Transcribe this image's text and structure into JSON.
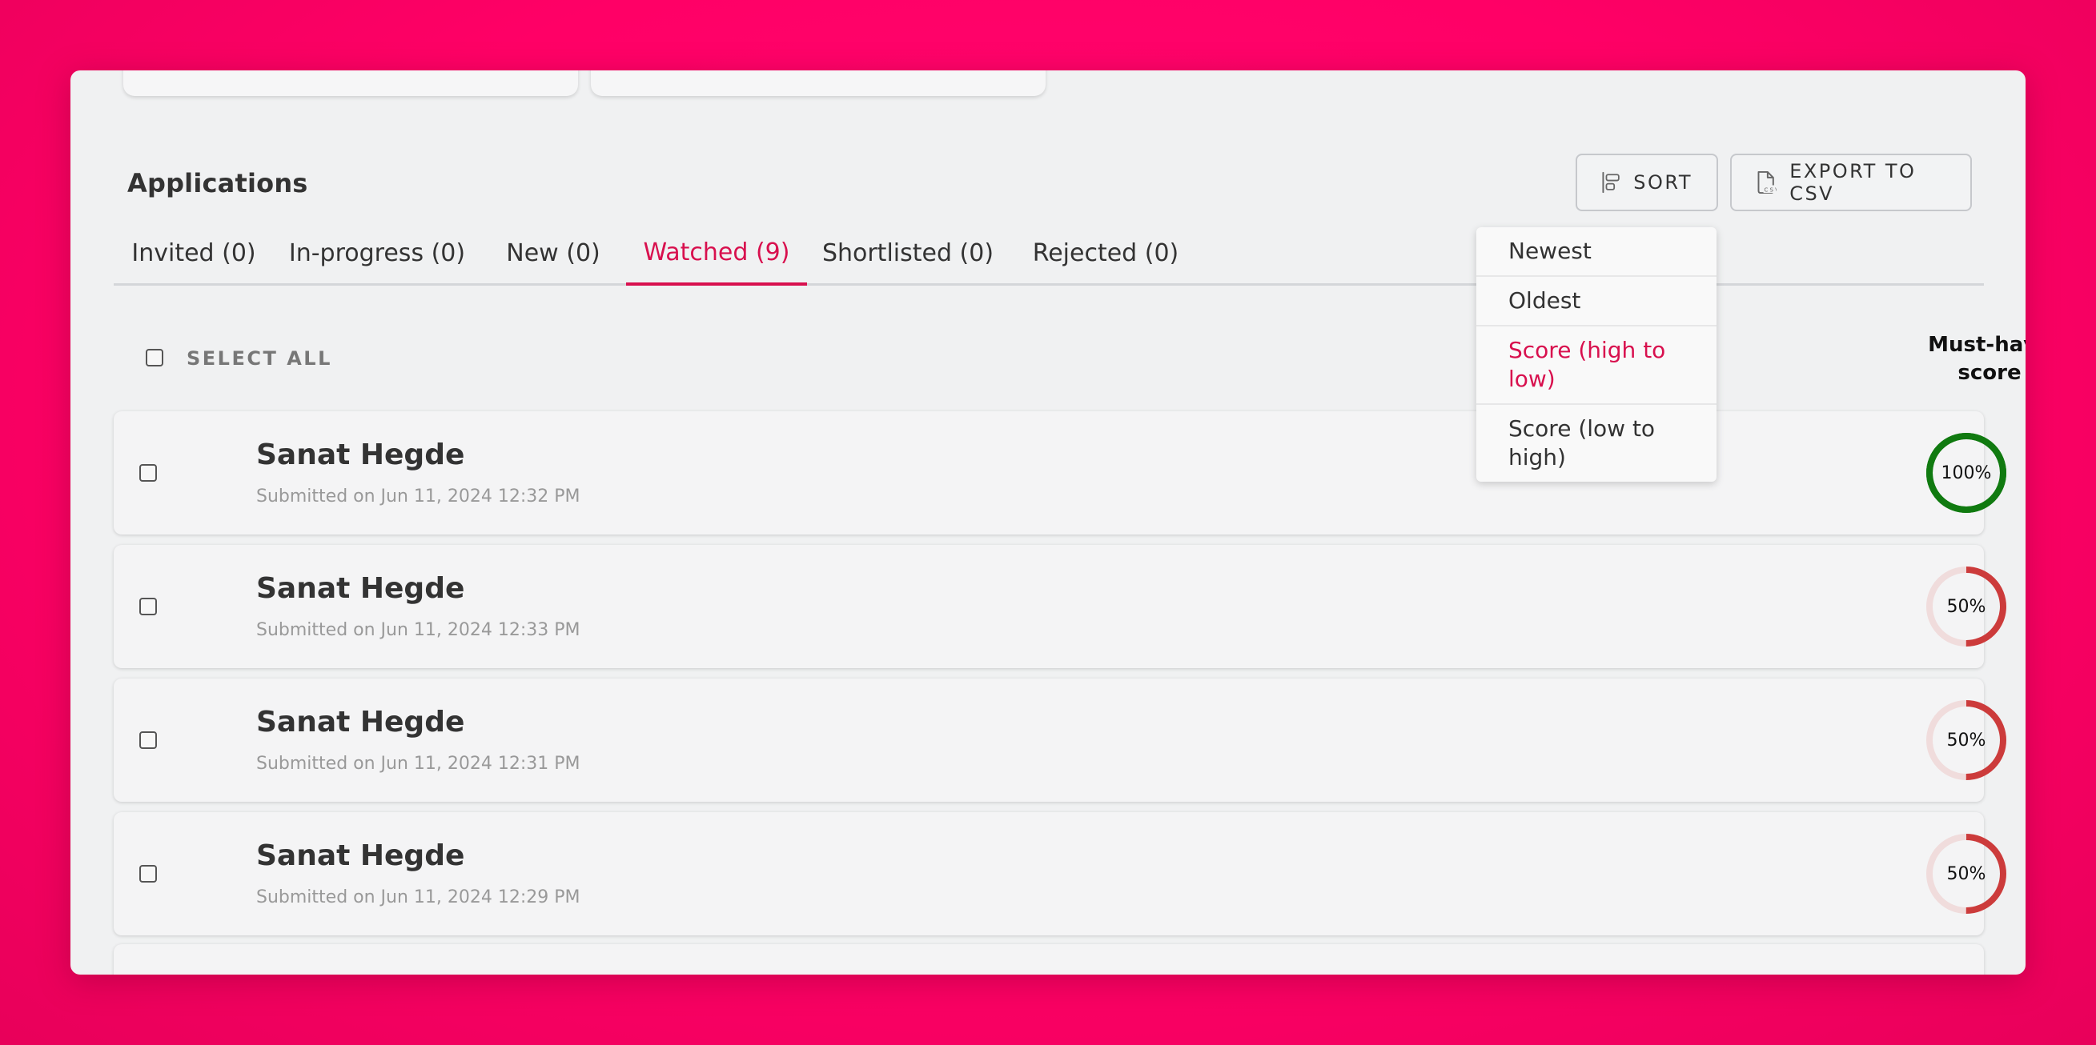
{
  "header": {
    "title": "Applications",
    "sort_label": "SORT",
    "export_label": "EXPORT TO CSV"
  },
  "tabs": [
    {
      "label": "Invited (0)",
      "active": false
    },
    {
      "label": "In-progress (0)",
      "active": false
    },
    {
      "label": "New (0)",
      "active": false
    },
    {
      "label": "Watched (9)",
      "active": true
    },
    {
      "label": "Shortlisted (0)",
      "active": false
    },
    {
      "label": "Rejected (0)",
      "active": false
    }
  ],
  "list": {
    "select_all_label": "SELECT ALL",
    "score_header": "Must-have score"
  },
  "applications": [
    {
      "name": "Sanat Hegde",
      "submitted": "Submitted on Jun 11, 2024 12:32 PM",
      "score_label": "100%",
      "score": 100
    },
    {
      "name": "Sanat Hegde",
      "submitted": "Submitted on Jun 11, 2024 12:33 PM",
      "score_label": "50%",
      "score": 50
    },
    {
      "name": "Sanat Hegde",
      "submitted": "Submitted on Jun 11, 2024 12:31 PM",
      "score_label": "50%",
      "score": 50
    },
    {
      "name": "Sanat Hegde",
      "submitted": "Submitted on Jun 11, 2024 12:29 PM",
      "score_label": "50%",
      "score": 50
    }
  ],
  "sort_menu": {
    "options": [
      "Newest",
      "Oldest",
      "Score (high to low)",
      "Score (low to high)"
    ],
    "selected": "Score (high to low)"
  },
  "colors": {
    "accent": "#d8104e",
    "score_full": "#107a10",
    "score_partial": "#cc3b3b",
    "score_track": "#f0dcdc"
  }
}
